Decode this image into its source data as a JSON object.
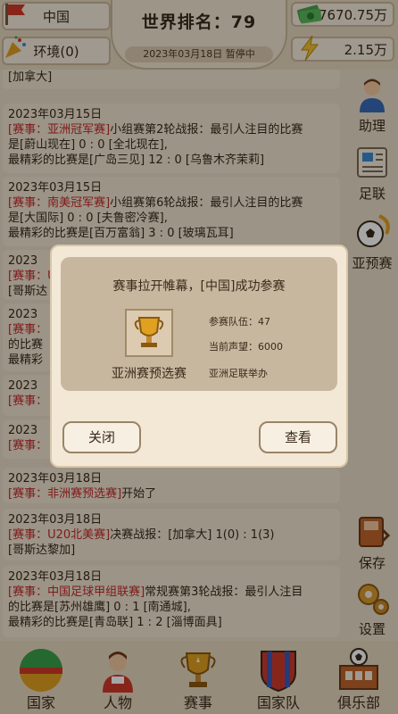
{
  "header": {
    "country": "中国",
    "environment": "环境(0)",
    "rank_title": "世界排名：79",
    "date_status": "2023年03月18日  暂停中",
    "money": "7670.75万",
    "energy": "2.15万"
  },
  "feed": {
    "top_partial": "[加拿大]",
    "items": [
      {
        "date": "2023年03月15日",
        "tag": "[赛事：亚洲冠军赛]",
        "lines": [
          "小组赛第2轮战报：最引人注目的比赛",
          "是[蔚山现在] 0 : 0 [全北现在],",
          "最精彩的比赛是[广岛三见] 12 : 0 [乌鲁木齐茉莉]"
        ]
      },
      {
        "date": "2023年03月15日",
        "tag": "[赛事：南美冠军赛]",
        "lines": [
          "小组赛第6轮战报：最引人注目的比赛",
          "是[大国际] 0 : 0 [夫鲁密冷赛],",
          "最精彩的比赛是[百万富翁] 3 : 0 [玻璃瓦耳]"
        ]
      },
      {
        "date": "2023年03月18日",
        "tag": "[赛事：非洲赛预选赛]",
        "lines": [
          "开始了"
        ]
      },
      {
        "date": "2023年03月18日",
        "tag": "[赛事：U20北美赛]",
        "lines": [
          "决赛战报：[加拿大] 1(0) : 1(3)",
          "[哥斯达黎加]"
        ]
      },
      {
        "date": "2023年03月18日",
        "tag": "[赛事：中国足球甲组联赛]",
        "lines": [
          "常规赛第3轮战报：最引人注目",
          "的比赛是[苏州雄鹰] 0 : 1 [南通城],",
          "最精彩的比赛是[青岛联] 1 : 2 [淄博面具]"
        ]
      }
    ],
    "hidden_fragments": [
      "2023",
      "[赛事：U",
      "[哥斯达",
      "2023",
      "[赛事：",
      "的比赛",
      "最精彩",
      "2023",
      "[赛事：",
      "2023",
      "[赛事："
    ]
  },
  "side_menu": {
    "assistant": "助理",
    "football_assoc": "足联",
    "asia_qual": "亚预赛",
    "save": "保存",
    "settings": "设置"
  },
  "bottom_nav": {
    "country": "国家",
    "people": "人物",
    "events": "赛事",
    "national_team": "国家队",
    "club": "俱乐部"
  },
  "modal": {
    "message": "赛事拉开帷幕，[中国]成功参赛",
    "trophy_label": "亚洲赛预选赛",
    "teams": "参赛队伍：47",
    "reputation": "当前声望：6000",
    "organizer": "亚洲足联举办",
    "close_label": "关闭",
    "view_label": "查看"
  },
  "colors": {
    "accent_red": "#c62828",
    "background": "#e9dcc6",
    "card": "#efe3cf"
  }
}
